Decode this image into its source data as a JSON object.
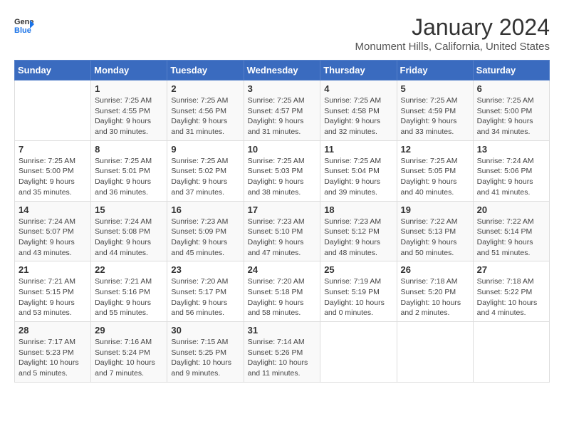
{
  "header": {
    "logo_general": "General",
    "logo_blue": "Blue",
    "title": "January 2024",
    "subtitle": "Monument Hills, California, United States"
  },
  "calendar": {
    "days_of_week": [
      "Sunday",
      "Monday",
      "Tuesday",
      "Wednesday",
      "Thursday",
      "Friday",
      "Saturday"
    ],
    "weeks": [
      [
        {
          "day": "",
          "info": ""
        },
        {
          "day": "1",
          "info": "Sunrise: 7:25 AM\nSunset: 4:55 PM\nDaylight: 9 hours\nand 30 minutes."
        },
        {
          "day": "2",
          "info": "Sunrise: 7:25 AM\nSunset: 4:56 PM\nDaylight: 9 hours\nand 31 minutes."
        },
        {
          "day": "3",
          "info": "Sunrise: 7:25 AM\nSunset: 4:57 PM\nDaylight: 9 hours\nand 31 minutes."
        },
        {
          "day": "4",
          "info": "Sunrise: 7:25 AM\nSunset: 4:58 PM\nDaylight: 9 hours\nand 32 minutes."
        },
        {
          "day": "5",
          "info": "Sunrise: 7:25 AM\nSunset: 4:59 PM\nDaylight: 9 hours\nand 33 minutes."
        },
        {
          "day": "6",
          "info": "Sunrise: 7:25 AM\nSunset: 5:00 PM\nDaylight: 9 hours\nand 34 minutes."
        }
      ],
      [
        {
          "day": "7",
          "info": "Sunrise: 7:25 AM\nSunset: 5:00 PM\nDaylight: 9 hours\nand 35 minutes."
        },
        {
          "day": "8",
          "info": "Sunrise: 7:25 AM\nSunset: 5:01 PM\nDaylight: 9 hours\nand 36 minutes."
        },
        {
          "day": "9",
          "info": "Sunrise: 7:25 AM\nSunset: 5:02 PM\nDaylight: 9 hours\nand 37 minutes."
        },
        {
          "day": "10",
          "info": "Sunrise: 7:25 AM\nSunset: 5:03 PM\nDaylight: 9 hours\nand 38 minutes."
        },
        {
          "day": "11",
          "info": "Sunrise: 7:25 AM\nSunset: 5:04 PM\nDaylight: 9 hours\nand 39 minutes."
        },
        {
          "day": "12",
          "info": "Sunrise: 7:25 AM\nSunset: 5:05 PM\nDaylight: 9 hours\nand 40 minutes."
        },
        {
          "day": "13",
          "info": "Sunrise: 7:24 AM\nSunset: 5:06 PM\nDaylight: 9 hours\nand 41 minutes."
        }
      ],
      [
        {
          "day": "14",
          "info": "Sunrise: 7:24 AM\nSunset: 5:07 PM\nDaylight: 9 hours\nand 43 minutes."
        },
        {
          "day": "15",
          "info": "Sunrise: 7:24 AM\nSunset: 5:08 PM\nDaylight: 9 hours\nand 44 minutes."
        },
        {
          "day": "16",
          "info": "Sunrise: 7:23 AM\nSunset: 5:09 PM\nDaylight: 9 hours\nand 45 minutes."
        },
        {
          "day": "17",
          "info": "Sunrise: 7:23 AM\nSunset: 5:10 PM\nDaylight: 9 hours\nand 47 minutes."
        },
        {
          "day": "18",
          "info": "Sunrise: 7:23 AM\nSunset: 5:12 PM\nDaylight: 9 hours\nand 48 minutes."
        },
        {
          "day": "19",
          "info": "Sunrise: 7:22 AM\nSunset: 5:13 PM\nDaylight: 9 hours\nand 50 minutes."
        },
        {
          "day": "20",
          "info": "Sunrise: 7:22 AM\nSunset: 5:14 PM\nDaylight: 9 hours\nand 51 minutes."
        }
      ],
      [
        {
          "day": "21",
          "info": "Sunrise: 7:21 AM\nSunset: 5:15 PM\nDaylight: 9 hours\nand 53 minutes."
        },
        {
          "day": "22",
          "info": "Sunrise: 7:21 AM\nSunset: 5:16 PM\nDaylight: 9 hours\nand 55 minutes."
        },
        {
          "day": "23",
          "info": "Sunrise: 7:20 AM\nSunset: 5:17 PM\nDaylight: 9 hours\nand 56 minutes."
        },
        {
          "day": "24",
          "info": "Sunrise: 7:20 AM\nSunset: 5:18 PM\nDaylight: 9 hours\nand 58 minutes."
        },
        {
          "day": "25",
          "info": "Sunrise: 7:19 AM\nSunset: 5:19 PM\nDaylight: 10 hours\nand 0 minutes."
        },
        {
          "day": "26",
          "info": "Sunrise: 7:18 AM\nSunset: 5:20 PM\nDaylight: 10 hours\nand 2 minutes."
        },
        {
          "day": "27",
          "info": "Sunrise: 7:18 AM\nSunset: 5:22 PM\nDaylight: 10 hours\nand 4 minutes."
        }
      ],
      [
        {
          "day": "28",
          "info": "Sunrise: 7:17 AM\nSunset: 5:23 PM\nDaylight: 10 hours\nand 5 minutes."
        },
        {
          "day": "29",
          "info": "Sunrise: 7:16 AM\nSunset: 5:24 PM\nDaylight: 10 hours\nand 7 minutes."
        },
        {
          "day": "30",
          "info": "Sunrise: 7:15 AM\nSunset: 5:25 PM\nDaylight: 10 hours\nand 9 minutes."
        },
        {
          "day": "31",
          "info": "Sunrise: 7:14 AM\nSunset: 5:26 PM\nDaylight: 10 hours\nand 11 minutes."
        },
        {
          "day": "",
          "info": ""
        },
        {
          "day": "",
          "info": ""
        },
        {
          "day": "",
          "info": ""
        }
      ]
    ]
  }
}
